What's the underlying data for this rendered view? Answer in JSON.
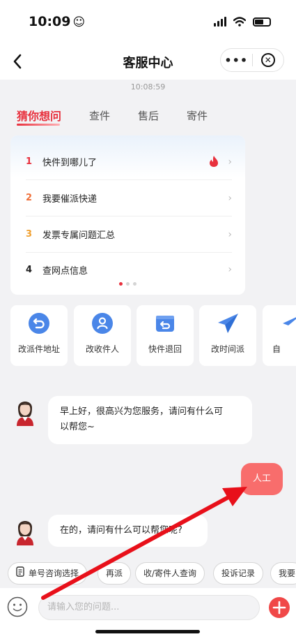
{
  "status_bar": {
    "time": "10:09"
  },
  "nav": {
    "title": "客服中心",
    "more_label": "•••",
    "close_label": "✕"
  },
  "timestamp": "10:08:59",
  "tabs": [
    {
      "label": "猜你想问",
      "active": true
    },
    {
      "label": "查件",
      "active": false
    },
    {
      "label": "售后",
      "active": false
    },
    {
      "label": "寄件",
      "active": false
    }
  ],
  "faq": [
    {
      "num": "1",
      "text": "快件到哪儿了",
      "num_color": "#e8303d",
      "hot": true
    },
    {
      "num": "2",
      "text": "我要催派快递",
      "num_color": "#f0703a",
      "hot": false
    },
    {
      "num": "3",
      "text": "发票专属问题汇总",
      "num_color": "#f0a030",
      "hot": false
    },
    {
      "num": "4",
      "text": "查网点信息",
      "num_color": "#222222",
      "hot": false
    }
  ],
  "faq_arrow": "›",
  "shortcuts": [
    {
      "label": "改派件地址",
      "icon": "undo-arrow-icon"
    },
    {
      "label": "改收件人",
      "icon": "person-icon"
    },
    {
      "label": "快件退回",
      "icon": "return-box-icon"
    },
    {
      "label": "改时间派",
      "icon": "paper-plane-icon"
    },
    {
      "label": "自",
      "icon": "paper-plane-icon"
    }
  ],
  "messages": {
    "agent_greeting_line1": "早上好，很高兴为您服务，请问有什么可",
    "agent_greeting_line2": "以帮您~",
    "user_message": "人工",
    "agent_reply": "在的，请问有什么可以帮您呢?"
  },
  "quick_replies": [
    "单号咨询选择",
    "再派",
    "收/寄件人查询",
    "投诉记录",
    "我要"
  ],
  "input": {
    "placeholder": "请输入您的问题..."
  },
  "colors": {
    "brand_red": "#e8303d",
    "user_bubble": "#f86d6c",
    "icon_blue": "#4a86e8",
    "plus_button": "#f04848",
    "annotation_arrow": "#e8101a"
  }
}
